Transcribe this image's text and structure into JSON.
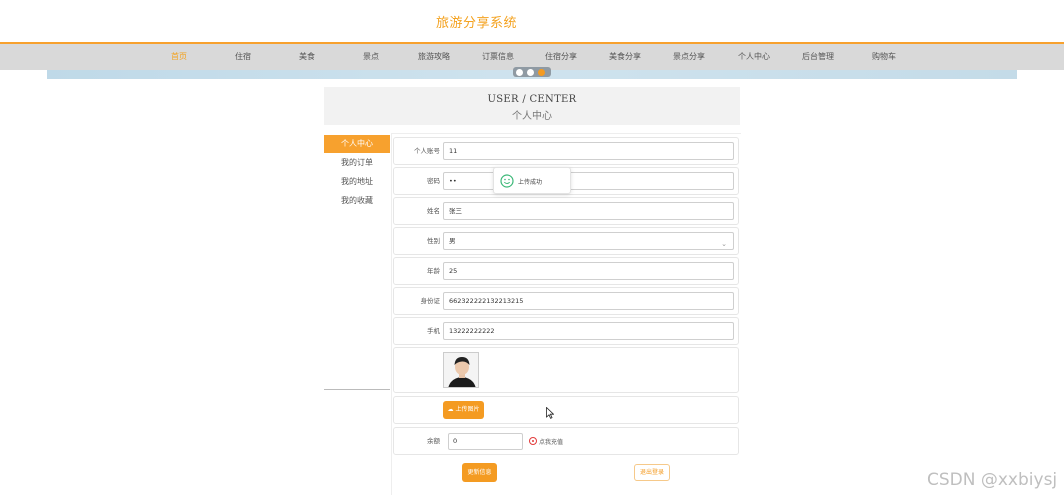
{
  "site": {
    "title": "旅游分享系统"
  },
  "nav": {
    "items": [
      {
        "label": "首页",
        "active": true
      },
      {
        "label": "住宿"
      },
      {
        "label": "美食"
      },
      {
        "label": "景点"
      },
      {
        "label": "旅游攻略"
      },
      {
        "label": "订票信息"
      },
      {
        "label": "住宿分享"
      },
      {
        "label": "美食分享"
      },
      {
        "label": "景点分享"
      },
      {
        "label": "个人中心"
      },
      {
        "label": "后台管理"
      },
      {
        "label": "购物车"
      }
    ]
  },
  "user_center": {
    "title_en": "USER / CENTER",
    "title_cn": "个人中心"
  },
  "sidebar": {
    "items": [
      {
        "label": "个人中心",
        "active": true
      },
      {
        "label": "我的订单"
      },
      {
        "label": "我的地址"
      },
      {
        "label": "我的收藏"
      }
    ]
  },
  "form": {
    "account": {
      "label": "个人账号",
      "value": "11"
    },
    "password": {
      "label": "密码",
      "value": "••"
    },
    "name": {
      "label": "姓名",
      "value": "张三"
    },
    "gender": {
      "label": "性别",
      "value": "男"
    },
    "age": {
      "label": "年龄",
      "value": "25"
    },
    "id_card": {
      "label": "身份证",
      "value": "662322222132213215"
    },
    "phone": {
      "label": "手机",
      "value": "13222222222"
    },
    "upload_button": "上传图片",
    "balance": {
      "label": "余额",
      "value": "0"
    },
    "recharge_label": "点我充值",
    "update_button": "更新信息",
    "logout_button": "退出登录"
  },
  "toast": {
    "text": "上传成功",
    "icon": "smile-icon"
  },
  "watermark": "CSDN @xxbiysj",
  "colors": {
    "accent": "#f49b22",
    "nav_bg": "#d9d9d9",
    "title": "#f4a21f"
  }
}
